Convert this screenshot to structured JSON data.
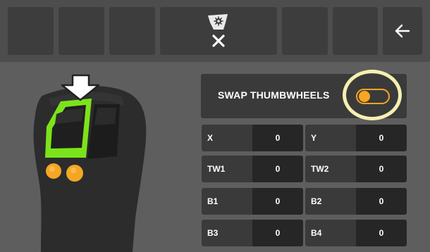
{
  "toolbar": {
    "buttons": [
      {
        "icon": "empty-slot"
      },
      {
        "icon": "empty-slot"
      },
      {
        "icon": "empty-slot"
      },
      {
        "icon": "machine-settings-cancel-icon"
      },
      {
        "icon": "empty-slot"
      },
      {
        "icon": "empty-slot"
      },
      {
        "icon": "back-arrow-icon"
      }
    ]
  },
  "swap": {
    "label": "SWAP THUMBWHEELS",
    "toggle_on": true
  },
  "values": [
    {
      "label": "X",
      "value": "0"
    },
    {
      "label": "Y",
      "value": "0"
    },
    {
      "label": "TW1",
      "value": "0"
    },
    {
      "label": "TW2",
      "value": "0"
    },
    {
      "label": "B1",
      "value": "0"
    },
    {
      "label": "B2",
      "value": "0"
    },
    {
      "label": "B3",
      "value": "0"
    },
    {
      "label": "B4",
      "value": "0"
    }
  ],
  "colors": {
    "accent_orange": "#f5a623",
    "highlight_green": "#7be31a",
    "ring_yellow": "#f4f0b0"
  }
}
